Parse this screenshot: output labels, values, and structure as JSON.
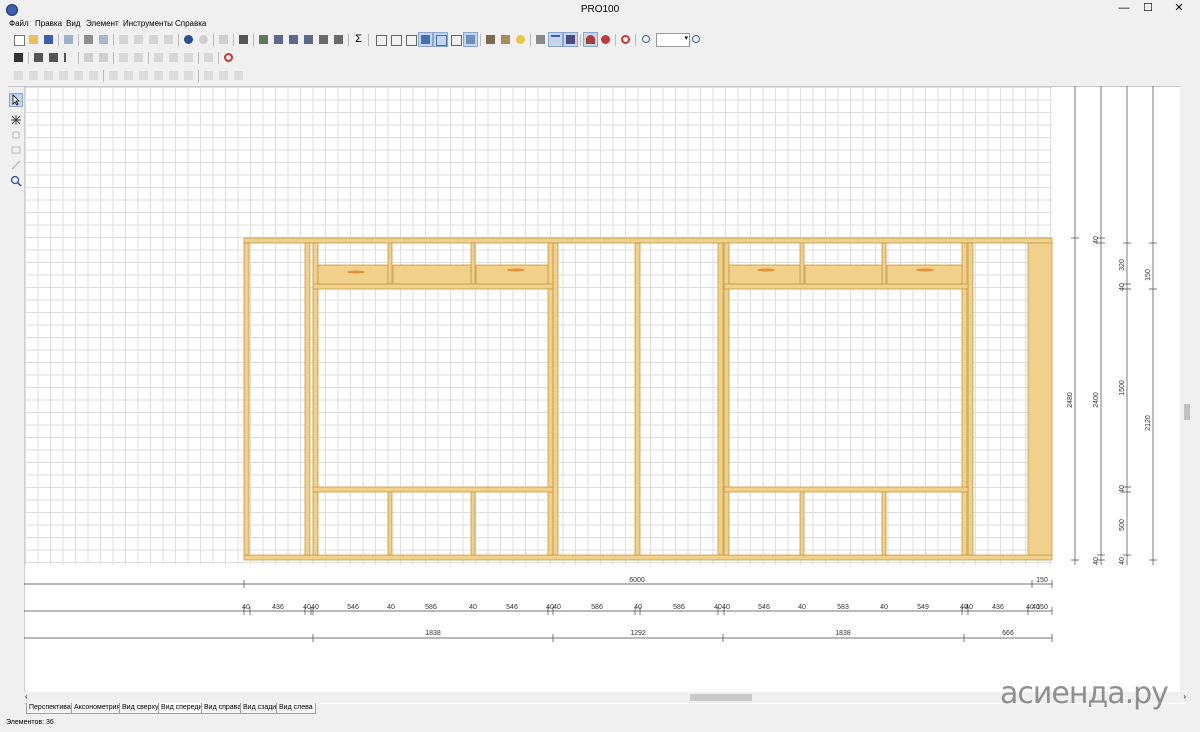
{
  "window": {
    "title": "PRO100",
    "minimize": "—",
    "maximize": "☐",
    "close": "✕"
  },
  "menu": [
    "Файл",
    "Правка",
    "Вид",
    "Элемент",
    "Инструменты",
    "Справка"
  ],
  "toolbar": {
    "zoom_value": ""
  },
  "drawing": {
    "overall_label": "6000",
    "end_label": "150",
    "row2_labels": [
      "40",
      "436",
      "40",
      "40",
      "546",
      "40",
      "586",
      "40",
      "546",
      "40",
      "40",
      "586",
      "40",
      "586",
      "40",
      "40",
      "546",
      "40",
      "583",
      "40",
      "549",
      "40",
      "40",
      "436",
      "40",
      "40",
      "150"
    ],
    "row3_labels": [
      "1838",
      "1292",
      "1838",
      "666"
    ],
    "vertical_col1": "2480",
    "vertical_col2": [
      "40",
      "2400",
      "40"
    ],
    "vertical_col3": [
      "320",
      "40",
      "1500",
      "40",
      "500",
      "40"
    ],
    "vertical_col4": [
      "150",
      "2120"
    ]
  },
  "tabs": [
    "Перспектива",
    "Аксонометрия",
    "Вид сверху",
    "Вид спереди",
    "Вид справа",
    "Вид сзади",
    "Вид слева"
  ],
  "active_tab": "Вид спереди",
  "status": "Элементов: 36",
  "watermark": "асиенда.ру",
  "colors": {
    "wood": "#f0d08a",
    "wood_edge": "#c59a45",
    "wood_knot": "#e88f3a"
  }
}
